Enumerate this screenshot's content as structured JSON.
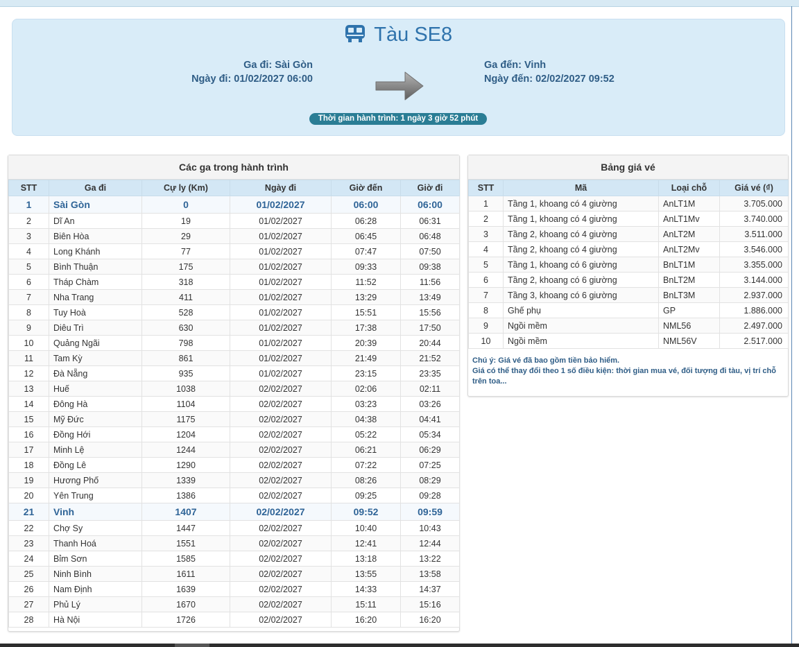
{
  "header": {
    "title": "Tàu SE8",
    "departure_station": "Ga đi: Sài Gòn",
    "departure_date": "Ngày đi: 01/02/2027 06:00",
    "arrival_station": "Ga đến: Vinh",
    "arrival_date": "Ngày đến: 02/02/2027 09:52",
    "duration": "Thời gian hành trình: 1 ngày 3 giờ 52 phút",
    "icon": "train-icon",
    "arrow_icon": "arrow-right-icon"
  },
  "stations": {
    "title": "Các ga trong hành trình",
    "columns": [
      "STT",
      "Ga đi",
      "Cự ly (Km)",
      "Ngày đi",
      "Giờ đến",
      "Giờ đi"
    ],
    "rows": [
      [
        "1",
        "Sài Gòn",
        "0",
        "01/02/2027",
        "06:00",
        "06:00"
      ],
      [
        "2",
        "Dĩ An",
        "19",
        "01/02/2027",
        "06:28",
        "06:31"
      ],
      [
        "3",
        "Biên Hòa",
        "29",
        "01/02/2027",
        "06:45",
        "06:48"
      ],
      [
        "4",
        "Long Khánh",
        "77",
        "01/02/2027",
        "07:47",
        "07:50"
      ],
      [
        "5",
        "Bình Thuận",
        "175",
        "01/02/2027",
        "09:33",
        "09:38"
      ],
      [
        "6",
        "Tháp Chàm",
        "318",
        "01/02/2027",
        "11:52",
        "11:56"
      ],
      [
        "7",
        "Nha Trang",
        "411",
        "01/02/2027",
        "13:29",
        "13:49"
      ],
      [
        "8",
        "Tuy Hoà",
        "528",
        "01/02/2027",
        "15:51",
        "15:56"
      ],
      [
        "9",
        "Diêu Trì",
        "630",
        "01/02/2027",
        "17:38",
        "17:50"
      ],
      [
        "10",
        "Quảng Ngãi",
        "798",
        "01/02/2027",
        "20:39",
        "20:44"
      ],
      [
        "11",
        "Tam Kỳ",
        "861",
        "01/02/2027",
        "21:49",
        "21:52"
      ],
      [
        "12",
        "Đà Nẵng",
        "935",
        "01/02/2027",
        "23:15",
        "23:35"
      ],
      [
        "13",
        "Huế",
        "1038",
        "02/02/2027",
        "02:06",
        "02:11"
      ],
      [
        "14",
        "Đông Hà",
        "1104",
        "02/02/2027",
        "03:23",
        "03:26"
      ],
      [
        "15",
        "Mỹ Đức",
        "1175",
        "02/02/2027",
        "04:38",
        "04:41"
      ],
      [
        "16",
        "Đồng Hới",
        "1204",
        "02/02/2027",
        "05:22",
        "05:34"
      ],
      [
        "17",
        "Minh Lệ",
        "1244",
        "02/02/2027",
        "06:21",
        "06:29"
      ],
      [
        "18",
        "Đồng Lê",
        "1290",
        "02/02/2027",
        "07:22",
        "07:25"
      ],
      [
        "19",
        "Hương Phố",
        "1339",
        "02/02/2027",
        "08:26",
        "08:29"
      ],
      [
        "20",
        "Yên Trung",
        "1386",
        "02/02/2027",
        "09:25",
        "09:28"
      ],
      [
        "21",
        "Vinh",
        "1407",
        "02/02/2027",
        "09:52",
        "09:59"
      ],
      [
        "22",
        "Chợ Sy",
        "1447",
        "02/02/2027",
        "10:40",
        "10:43"
      ],
      [
        "23",
        "Thanh Hoá",
        "1551",
        "02/02/2027",
        "12:41",
        "12:44"
      ],
      [
        "24",
        "Bỉm Sơn",
        "1585",
        "02/02/2027",
        "13:18",
        "13:22"
      ],
      [
        "25",
        "Ninh Bình",
        "1611",
        "02/02/2027",
        "13:55",
        "13:58"
      ],
      [
        "26",
        "Nam Định",
        "1639",
        "02/02/2027",
        "14:33",
        "14:37"
      ],
      [
        "27",
        "Phủ Lý",
        "1670",
        "02/02/2027",
        "15:11",
        "15:16"
      ],
      [
        "28",
        "Hà Nội",
        "1726",
        "02/02/2027",
        "16:20",
        "16:20"
      ]
    ],
    "highlighted_rows": [
      0,
      20
    ]
  },
  "prices": {
    "title": "Bảng giá vé",
    "columns": [
      "STT",
      "Mã",
      "Loại chỗ",
      "Giá vé (₫)"
    ],
    "rows": [
      [
        "1",
        "Tầng 1, khoang có 4 giường",
        "AnLT1M",
        "3.705.000"
      ],
      [
        "2",
        "Tầng 1, khoang có 4 giường",
        "AnLT1Mv",
        "3.740.000"
      ],
      [
        "3",
        "Tầng 2, khoang có 4 giường",
        "AnLT2M",
        "3.511.000"
      ],
      [
        "4",
        "Tầng 2, khoang có 4 giường",
        "AnLT2Mv",
        "3.546.000"
      ],
      [
        "5",
        "Tầng 1, khoang có 6 giường",
        "BnLT1M",
        "3.355.000"
      ],
      [
        "6",
        "Tầng 2, khoang có 6 giường",
        "BnLT2M",
        "3.144.000"
      ],
      [
        "7",
        "Tầng 3, khoang có 6 giường",
        "BnLT3M",
        "2.937.000"
      ],
      [
        "8",
        "Ghế phụ",
        "GP",
        "1.886.000"
      ],
      [
        "9",
        "Ngồi mềm",
        "NML56",
        "2.497.000"
      ],
      [
        "10",
        "Ngồi mềm",
        "NML56V",
        "2.517.000"
      ]
    ],
    "note_line1": "Chú ý: Giá vé đã bao gồm tiền bảo hiểm.",
    "note_line2": "Giá có thể thay đổi theo 1 số điều kiện: thời gian mua vé, đối tượng đi tàu, vị trí chỗ trên toa..."
  },
  "colors": {
    "header_bg": "#d9ecf8",
    "title_blue": "#2f73ac",
    "table_header_bg": "#d3e7f5",
    "duration_badge": "#2a7d95",
    "highlight_text": "#2f6497"
  }
}
